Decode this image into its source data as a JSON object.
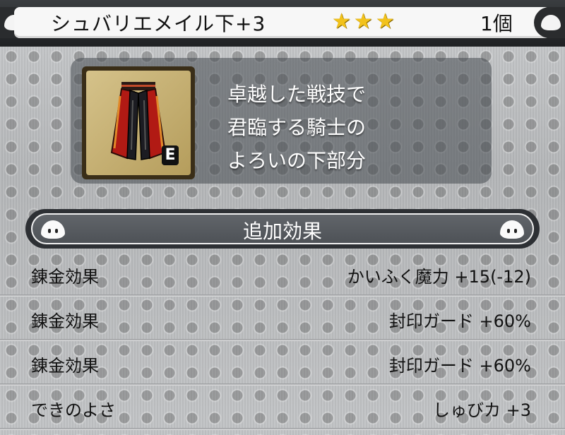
{
  "header": {
    "item_name": "シュバリエメイル下+3",
    "star_count": 3,
    "star_color": "#f2c21b",
    "count": "1個",
    "left_icon": "slime-icon",
    "right_icon": "slime-icon"
  },
  "item": {
    "icon": "armor-pants-icon",
    "equipped_badge": "E",
    "description_lines": [
      "卓越した戦技で",
      "君臨する騎士の",
      "よろいの下部分"
    ]
  },
  "section": {
    "title": "追加効果",
    "left_icon": "slime-icon",
    "right_icon": "slime-icon"
  },
  "effects": [
    {
      "label": "錬金効果",
      "value": "かいふく魔力 +15(-12)"
    },
    {
      "label": "錬金効果",
      "value": "封印ガード +60%"
    },
    {
      "label": "錬金効果",
      "value": "封印ガード +60%"
    },
    {
      "label": "できのよさ",
      "value": "しゅびカ +3"
    }
  ]
}
